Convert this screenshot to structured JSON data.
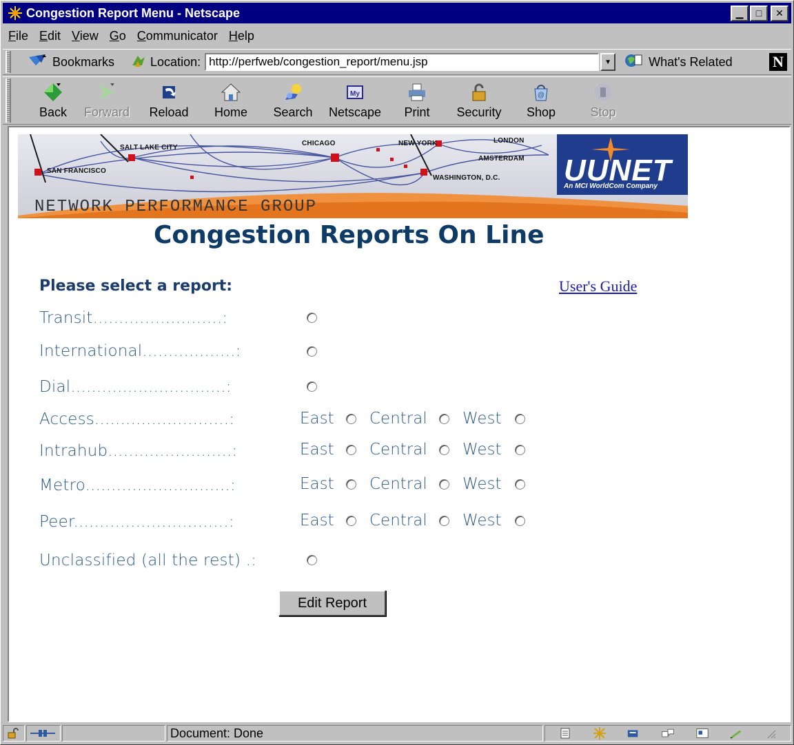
{
  "window": {
    "title": "Congestion Report Menu - Netscape",
    "minimize_glyph": "▁",
    "maximize_glyph": "□",
    "close_glyph": "✕"
  },
  "menu": [
    "File",
    "Edit",
    "View",
    "Go",
    "Communicator",
    "Help"
  ],
  "location_bar": {
    "bookmarks_label": "Bookmarks",
    "location_label": "Location:",
    "url": "http://perfweb/congestion_report/menu.jsp",
    "related_label": "What's Related",
    "netscape_logo": "N"
  },
  "toolbar": [
    {
      "label": "Back",
      "enabled": true,
      "icon": "back-arrow-icon"
    },
    {
      "label": "Forward",
      "enabled": false,
      "icon": "forward-arrow-icon"
    },
    {
      "label": "Reload",
      "enabled": true,
      "icon": "reload-icon"
    },
    {
      "label": "Home",
      "enabled": true,
      "icon": "home-icon"
    },
    {
      "label": "Search",
      "enabled": true,
      "icon": "search-icon"
    },
    {
      "label": "Netscape",
      "enabled": true,
      "icon": "netscape-icon"
    },
    {
      "label": "Print",
      "enabled": true,
      "icon": "printer-icon"
    },
    {
      "label": "Security",
      "enabled": true,
      "icon": "lock-icon"
    },
    {
      "label": "Shop",
      "enabled": true,
      "icon": "shop-icon"
    },
    {
      "label": "Stop",
      "enabled": false,
      "icon": "stop-icon"
    }
  ],
  "banner": {
    "cities": [
      "SALT LAKE CITY",
      "SAN FRANCISCO",
      "CHICAGO",
      "NEW YORK",
      "LONDON",
      "AMSTERDAM",
      "WASHINGTON, D.C."
    ],
    "group_name": "NETWORK PERFORMANCE GROUP",
    "brand": "UUNET",
    "brand_sub": "An MCI WorldCom Company"
  },
  "page": {
    "title": "Congestion Reports On Line",
    "prompt": "Please select a report:",
    "guide_link": "User's Guide",
    "submit_label": "Edit Report",
    "region_labels": [
      "East",
      "Central",
      "West"
    ],
    "rows": [
      {
        "label": "Transit.........................:",
        "regional": false
      },
      {
        "label": "International..................:",
        "regional": false
      },
      {
        "label": "Dial..............................:",
        "regional": false
      },
      {
        "label": "Access..........................:",
        "regional": true
      },
      {
        "label": "Intrahub........................:",
        "regional": true
      },
      {
        "label": "Metro............................:",
        "regional": true
      },
      {
        "label": "Peer..............................:",
        "regional": true
      },
      {
        "label": "Unclassified (all the rest) .:",
        "regional": false
      }
    ]
  },
  "statusbar": {
    "text": "Document: Done"
  },
  "colors": {
    "title_bar": "#000080",
    "heading": "#0d3b66",
    "label": "#2a5a8a",
    "link": "#1a1aa8",
    "brand_blue": "#1f3d8c",
    "banner_orange": "#f28a2e"
  }
}
